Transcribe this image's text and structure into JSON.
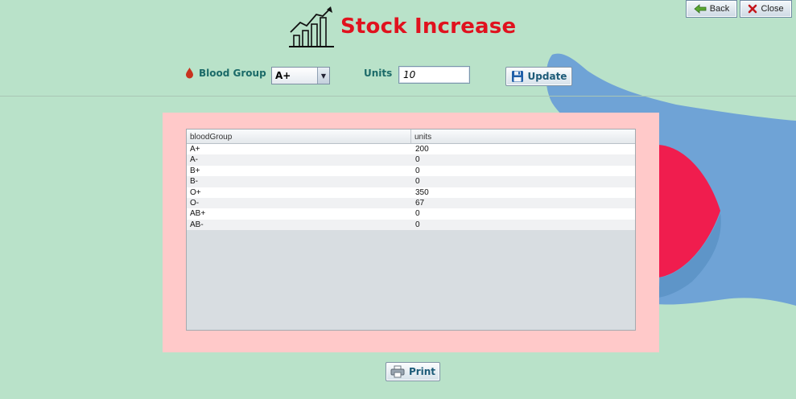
{
  "header": {
    "title": "Stock Increase"
  },
  "window_buttons": {
    "back_label": "Back",
    "close_label": "Close"
  },
  "form": {
    "blood_group_label": "Blood Group",
    "blood_group_selected": "A+",
    "units_label": "Units",
    "units_value": "10",
    "update_label": "Update"
  },
  "table": {
    "columns": [
      "bloodGroup",
      "units"
    ],
    "rows": [
      [
        "A+",
        "200"
      ],
      [
        "A-",
        "0"
      ],
      [
        "B+",
        "0"
      ],
      [
        "B-",
        "0"
      ],
      [
        "O+",
        "350"
      ],
      [
        "O-",
        "67"
      ],
      [
        "AB+",
        "0"
      ],
      [
        "AB-",
        "0"
      ]
    ]
  },
  "footer": {
    "print_label": "Print"
  },
  "colors": {
    "background": "#b9e2c9",
    "title": "#e0121e",
    "label": "#1b6a68",
    "panel": "#ffc9c9",
    "hand_blue": "#6fa3d6",
    "drop_red": "#f01d4e"
  },
  "icons": {
    "title": "stock-chart-icon",
    "back": "back-arrow-icon",
    "close": "close-x-icon",
    "blood_group": "blood-drop-icon",
    "update": "floppy-disk-icon",
    "print": "printer-icon"
  }
}
